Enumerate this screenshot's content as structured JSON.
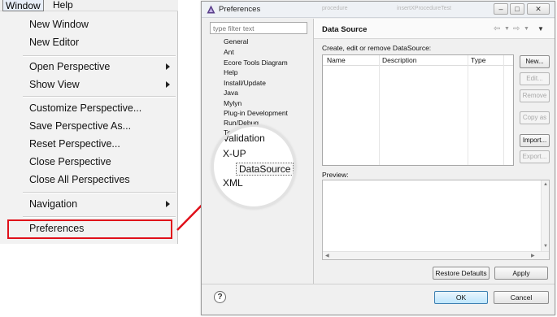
{
  "menubar": {
    "window": "Window",
    "help": "Help"
  },
  "window_menu": {
    "items": [
      {
        "label": "New Window"
      },
      {
        "label": "New Editor"
      },
      {
        "label": "Open Perspective"
      },
      {
        "label": "Show View"
      },
      {
        "label": "Customize Perspective..."
      },
      {
        "label": "Save Perspective As..."
      },
      {
        "label": "Reset Perspective..."
      },
      {
        "label": "Close Perspective"
      },
      {
        "label": "Close All Perspectives"
      },
      {
        "label": "Navigation"
      },
      {
        "label": "Preferences"
      }
    ],
    "highlight_color": "#e0101a"
  },
  "dialog": {
    "title": "Preferences",
    "background_tabs": [
      "procedure",
      "insertXProcedureTest"
    ],
    "filter_placeholder": "type filter text",
    "tree": [
      "General",
      "Ant",
      "Ecore Tools Diagram",
      "Help",
      "Install/Update",
      "Java",
      "Mylyn",
      "Plug-in Development",
      "Run/Debug",
      "Team"
    ],
    "zoom": {
      "items": [
        "Validation",
        "X-UP",
        "DataSource",
        "XML"
      ],
      "selected": "DataSource"
    },
    "page": {
      "title": "Data Source",
      "description": "Create, edit or remove DataSource:",
      "columns": [
        "Name",
        "Description",
        "Type"
      ],
      "side_buttons": [
        "New...",
        "Edit...",
        "Remove",
        "Copy as",
        "Import...",
        "Export..."
      ],
      "preview_label": "Preview:",
      "restore_defaults": "Restore Defaults",
      "apply": "Apply"
    },
    "ok": "OK",
    "cancel": "Cancel",
    "help_symbol": "?"
  }
}
